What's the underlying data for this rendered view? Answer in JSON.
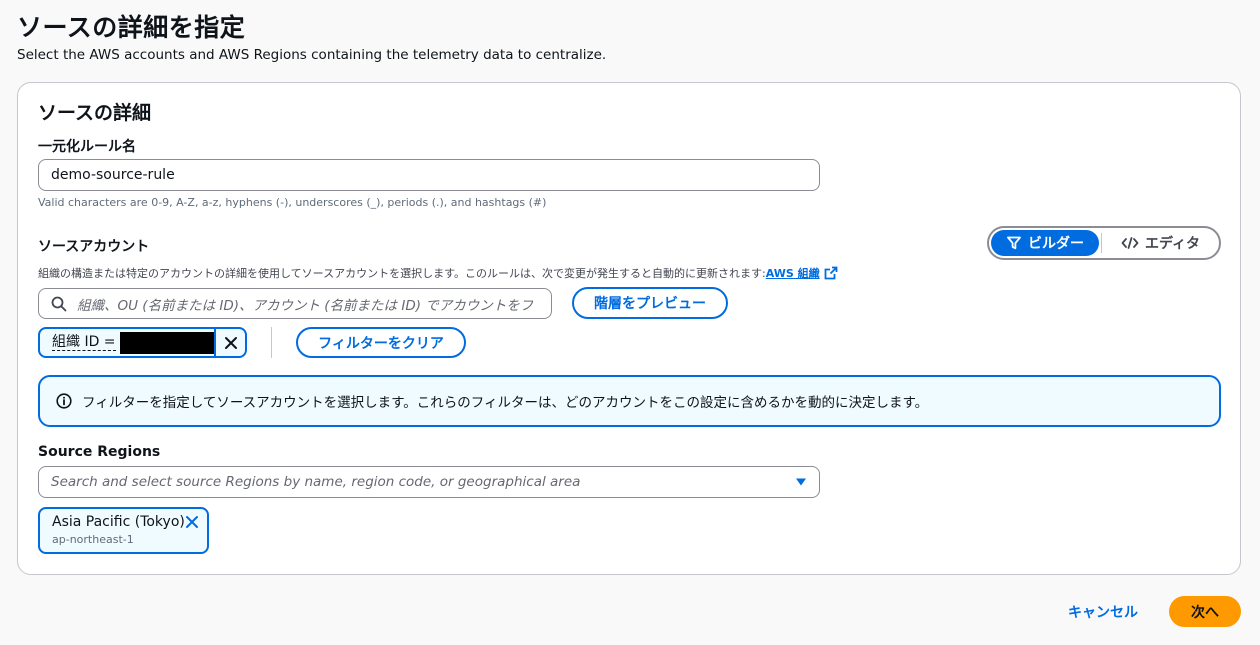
{
  "header": {
    "title": "ソースの詳細を指定",
    "description": "Select the AWS accounts and AWS Regions containing the telemetry data to centralize."
  },
  "panel": {
    "title": "ソースの詳細",
    "rule_name": {
      "label": "一元化ルール名",
      "value": "demo-source-rule",
      "hint": "Valid characters are 0-9, A-Z, a-z, hyphens (-), underscores (_), periods (.), and hashtags (#)"
    },
    "source_accounts": {
      "label": "ソースアカウント",
      "mode_toggle": {
        "builder_label": "ビルダー",
        "editor_label": "エディタ",
        "selected": "builder"
      },
      "description": "組織の構造または特定のアカウントの詳細を使用してソースアカウントを選択します。このルールは、次で変更が発生すると自動的に更新されます: ",
      "link_label": "AWS 組織",
      "search_placeholder": "組織、OU (名前または ID)、アカウント (名前または ID) でアカウントをフ",
      "preview_button": "階層をプレビュー",
      "filter_token_label": "組織 ID =",
      "clear_filters_button": "フィルターをクリア",
      "info_alert": "フィルターを指定してソースアカウントを選択します。これらのフィルターは、どのアカウントをこの設定に含めるかを動的に決定します。"
    },
    "source_regions": {
      "label": "Source Regions",
      "placeholder": "Search and select source Regions by name, region code, or geographical area",
      "selected": [
        {
          "name": "Asia Pacific (Tokyo)",
          "code": "ap-northeast-1"
        }
      ]
    }
  },
  "footer": {
    "cancel_label": "キャンセル",
    "next_label": "次へ"
  },
  "colors": {
    "accent": "#006ce0",
    "primary_button": "#ff9900",
    "border": "#8c8c94"
  }
}
